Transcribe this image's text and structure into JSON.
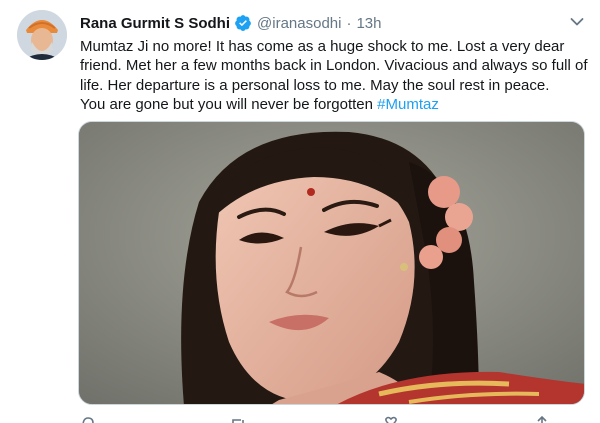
{
  "tweet": {
    "author": {
      "display_name": "Rana Gurmit S Sodhi",
      "handle": "@iranasodhi",
      "verified": true
    },
    "separator": "·",
    "timestamp": "13h",
    "text_lines": [
      "Mumtaz Ji no more! It has come as a huge shock to me. Lost a very dear",
      "friend. Met her a few months back in London. Vivacious and always so full of",
      "life. Her departure is a personal loss to me. May the soul rest in peace.",
      "You are gone but you will never be forgotten "
    ],
    "hashtag": "#Mumtaz",
    "colors": {
      "link": "#1da1f2",
      "secondary_text": "#657786",
      "primary_text": "#14171a"
    },
    "icons": [
      "verified-badge-icon",
      "chevron-down-icon",
      "reply-icon",
      "retweet-icon",
      "like-icon",
      "share-icon"
    ]
  }
}
